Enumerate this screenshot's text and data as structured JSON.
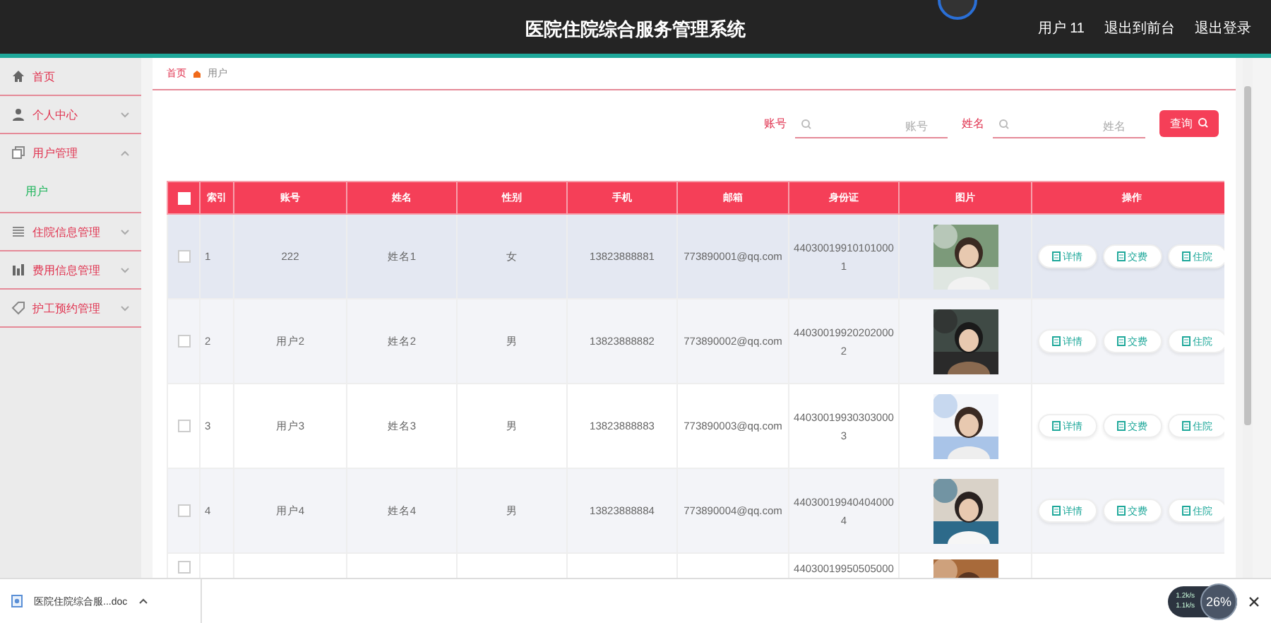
{
  "header": {
    "title": "医院住院综合服务管理系统",
    "user": "用户 11",
    "links": [
      "退出到前台",
      "退出登录"
    ]
  },
  "sidebar": {
    "items": [
      {
        "label": "首页"
      },
      {
        "label": "个人中心",
        "expanded": false
      },
      {
        "label": "用户管理",
        "expanded": true,
        "children": [
          {
            "label": "用户",
            "selected": true
          }
        ]
      },
      {
        "label": "住院信息管理",
        "expanded": false
      },
      {
        "label": "费用信息管理",
        "expanded": false
      },
      {
        "label": "护工预约管理",
        "expanded": false
      }
    ]
  },
  "breadcrumb": [
    "首页",
    "用户"
  ],
  "search": {
    "fields": [
      {
        "label": "账号",
        "placeholder": "账号"
      },
      {
        "label": "姓名",
        "placeholder": "姓名"
      }
    ],
    "button": "查询"
  },
  "table": {
    "header_checked": false,
    "columns": [
      "索引",
      "账号",
      "姓名",
      "性别",
      "手机",
      "邮箱",
      "身份证",
      "图片",
      "操作"
    ],
    "rows": [
      {
        "checked": false,
        "hovered": true,
        "cells": [
          "1",
          "222",
          "姓名1",
          "女",
          "13823888881",
          "773890001@qq.com",
          "440300199101010001"
        ],
        "actions": [
          "详情",
          "交费",
          "住院"
        ]
      },
      {
        "checked": false,
        "hovered": false,
        "cells": [
          "2",
          "用户2",
          "姓名2",
          "男",
          "13823888882",
          "773890002@qq.com",
          "440300199202020002"
        ],
        "actions": [
          "详情",
          "交费",
          "住院"
        ]
      },
      {
        "checked": false,
        "hovered": false,
        "cells": [
          "3",
          "用户3",
          "姓名3",
          "男",
          "13823888883",
          "773890003@qq.com",
          "440300199303030003"
        ],
        "actions": [
          "详情",
          "交费",
          "住院"
        ]
      },
      {
        "checked": false,
        "hovered": false,
        "cells": [
          "4",
          "用户4",
          "姓名4",
          "男",
          "13823888884",
          "773890004@qq.com",
          "440300199404040004"
        ],
        "actions": [
          "详情",
          "交费",
          "住院"
        ]
      },
      {
        "checked": false,
        "hovered": false,
        "cells": [
          "",
          "",
          "",
          "",
          "",
          "",
          "44030019950505000"
        ],
        "actions": []
      }
    ]
  },
  "download_bar": {
    "file": "医院住院综合服...doc",
    "speed_up": "1.2k/s",
    "speed_down": "1.1k/s",
    "badge": "26%"
  }
}
